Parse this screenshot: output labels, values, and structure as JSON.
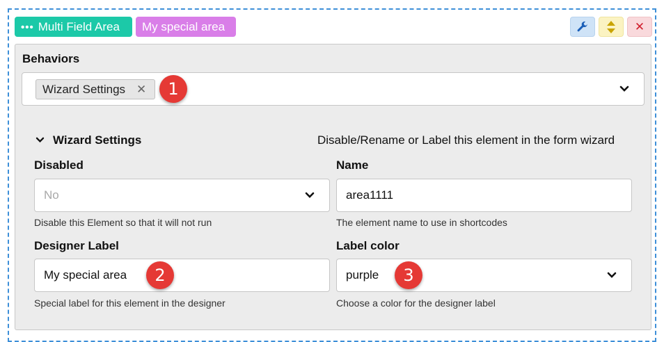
{
  "header": {
    "type_tag": "Multi Field Area",
    "designer_tag": "My special area",
    "controls": {
      "wrench_icon": "wrench-icon",
      "move_icon": "up-down-icon",
      "close_icon": "close-icon",
      "close_glyph": "✕"
    }
  },
  "behaviors": {
    "label": "Behaviors",
    "selected": [
      {
        "label": "Wizard Settings",
        "remove_glyph": "✕"
      }
    ]
  },
  "wizard_settings": {
    "title": "Wizard Settings",
    "description": "Disable/Rename or Label this element in the form wizard",
    "fields": {
      "disabled": {
        "label": "Disabled",
        "value": "No",
        "help": "Disable this Element so that it will not run"
      },
      "name": {
        "label": "Name",
        "value": "area1111",
        "help": "The element name to use in shortcodes"
      },
      "designer_label": {
        "label": "Designer Label",
        "value": "My special area",
        "help": "Special label for this element in the designer"
      },
      "label_color": {
        "label": "Label color",
        "value": "purple",
        "help": "Choose a color for the designer label"
      }
    }
  },
  "callouts": [
    "1",
    "2",
    "3"
  ],
  "colors": {
    "teal": "#1cc9a8",
    "purple": "#d97ee8",
    "badge": "#e53935",
    "dashed_border": "#3d8fd8"
  }
}
